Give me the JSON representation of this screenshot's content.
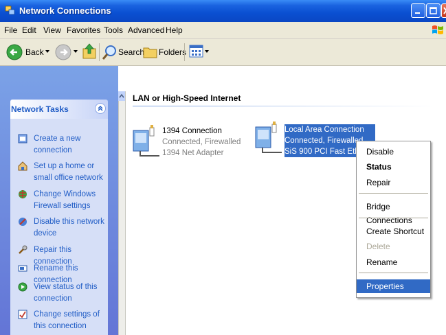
{
  "window": {
    "title": "Network Connections"
  },
  "menubar": {
    "items": [
      "File",
      "Edit",
      "View",
      "Favorites",
      "Tools",
      "Advanced",
      "Help"
    ]
  },
  "toolbar": {
    "back": "Back",
    "search": "Search",
    "folders": "Folders"
  },
  "taskpane": {
    "title": "Network Tasks",
    "tasks": [
      "Create a new connection",
      "Set up a home or small office network",
      "Change Windows Firewall settings",
      "Disable this network device",
      "Repair this connection",
      "Rename this connection",
      "View status of this connection",
      "Change settings of this connection"
    ]
  },
  "content": {
    "group_title": "LAN or High-Speed Internet",
    "connections": [
      {
        "name": "1394 Connection",
        "status": "Connected, Firewalled",
        "device": "1394 Net Adapter"
      },
      {
        "name": "Local Area Connection",
        "status": "Connected, Firewalled",
        "device": "SiS 900 PCI Fast Ethernet"
      }
    ]
  },
  "context_menu": {
    "items": [
      "Disable",
      "Status",
      "Repair",
      "Bridge Connections",
      "Create Shortcut",
      "Delete",
      "Rename",
      "Properties"
    ],
    "default_item": "Status",
    "disabled_item": "Delete",
    "highlighted_item": "Properties"
  },
  "colors": {
    "titlebar": "#0a4fd1",
    "selection": "#316ac5",
    "task_link": "#215dc6",
    "taskpane_bg": "#6375d6"
  }
}
